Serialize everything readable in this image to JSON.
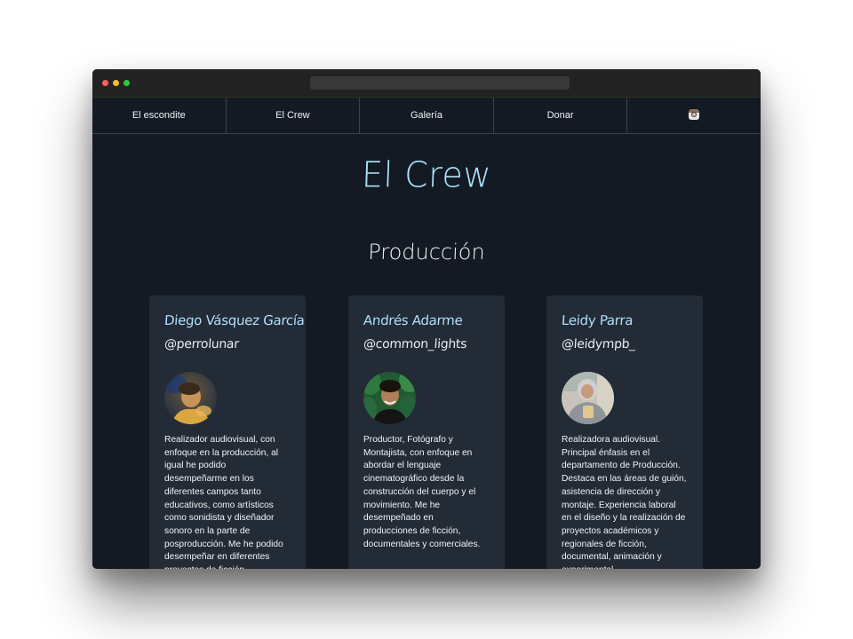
{
  "nav": {
    "items": [
      {
        "label": "El escondite"
      },
      {
        "label": "El Crew"
      },
      {
        "label": "Galería"
      },
      {
        "label": "Donar"
      }
    ],
    "social_icon": "instagram-icon"
  },
  "page": {
    "title": "El Crew",
    "section": "Producción"
  },
  "crew": [
    {
      "name": "Diego Vásquez García",
      "handle": "@perrolunar",
      "bio": "Realizador audiovisual, con enfoque en la producción, al igual he podido desempeñarme en los diferentes campos tanto educativos, como artísticos como sonidista y diseñador sonoro en la parte de posproducción. Me he podido desempeñar en diferentes proyectos de ficción, documentales y animación."
    },
    {
      "name": "Andrés Adarme",
      "handle": "@common_lights",
      "bio": "Productor, Fotógrafo y Montajista, con enfoque en abordar el lenguaje cinematográfico desde la construcción del cuerpo y el movimiento. Me he desempeñado en producciones de ficción, documentales y comerciales."
    },
    {
      "name": "Leidy Parra",
      "handle": "@leidympb_",
      "bio": "Realizadora audiovisual. Principal énfasis en el departamento de Producción. Destaca en las áreas de guión, asistencia de dirección y montaje. Experiencia laboral en el diseño y la realización de proyectos académicos y regionales de ficción, documental, animación y experimental."
    }
  ],
  "colors": {
    "background": "#131a23",
    "card": "#222b36",
    "accent": "#aee0fb",
    "text": "#f2f4f7"
  }
}
